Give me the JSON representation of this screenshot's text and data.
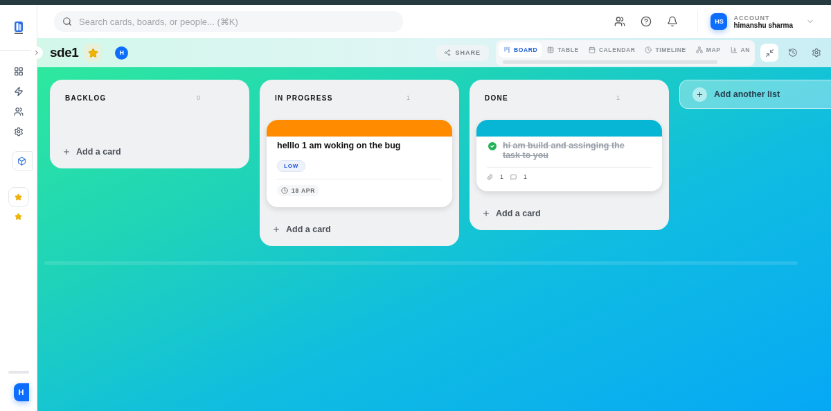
{
  "search": {
    "placeholder": "Search cards, boards, or people... (⌘K)"
  },
  "account": {
    "initials": "HS",
    "label": "ACCOUNT",
    "name": "himanshu sharma"
  },
  "sidebar": {
    "user_initial": "H"
  },
  "board": {
    "title": "sde1",
    "starred": true,
    "member": "H"
  },
  "share": "SHARE",
  "views": [
    {
      "label": "BOARD",
      "kind": "board",
      "selected": true
    },
    {
      "label": "TABLE",
      "kind": "table",
      "selected": false
    },
    {
      "label": "CALENDAR",
      "kind": "calendar",
      "selected": false
    },
    {
      "label": "TIMELINE",
      "kind": "timeline",
      "selected": false
    },
    {
      "label": "MAP",
      "kind": "map",
      "selected": false
    },
    {
      "label": "AN",
      "kind": "analytics",
      "selected": false
    }
  ],
  "lists": [
    {
      "title": "BACKLOG",
      "count": "0",
      "add": "Add a card"
    },
    {
      "title": "IN PROGRESS",
      "count": "1",
      "add": "Add a card",
      "cards": [
        {
          "title": "helllo 1 am woking on the bug",
          "color": "#ff8c00",
          "done": false,
          "priority": "LOW",
          "due": "18 APR"
        }
      ]
    },
    {
      "title": "DONE",
      "count": "1",
      "add": "Add a card",
      "cards": [
        {
          "title": "hi am build and assinging the task to you",
          "color": "#06b6d4",
          "done": true,
          "attachments": "1",
          "comments": "1"
        }
      ]
    }
  ],
  "add_list": "Add another list"
}
